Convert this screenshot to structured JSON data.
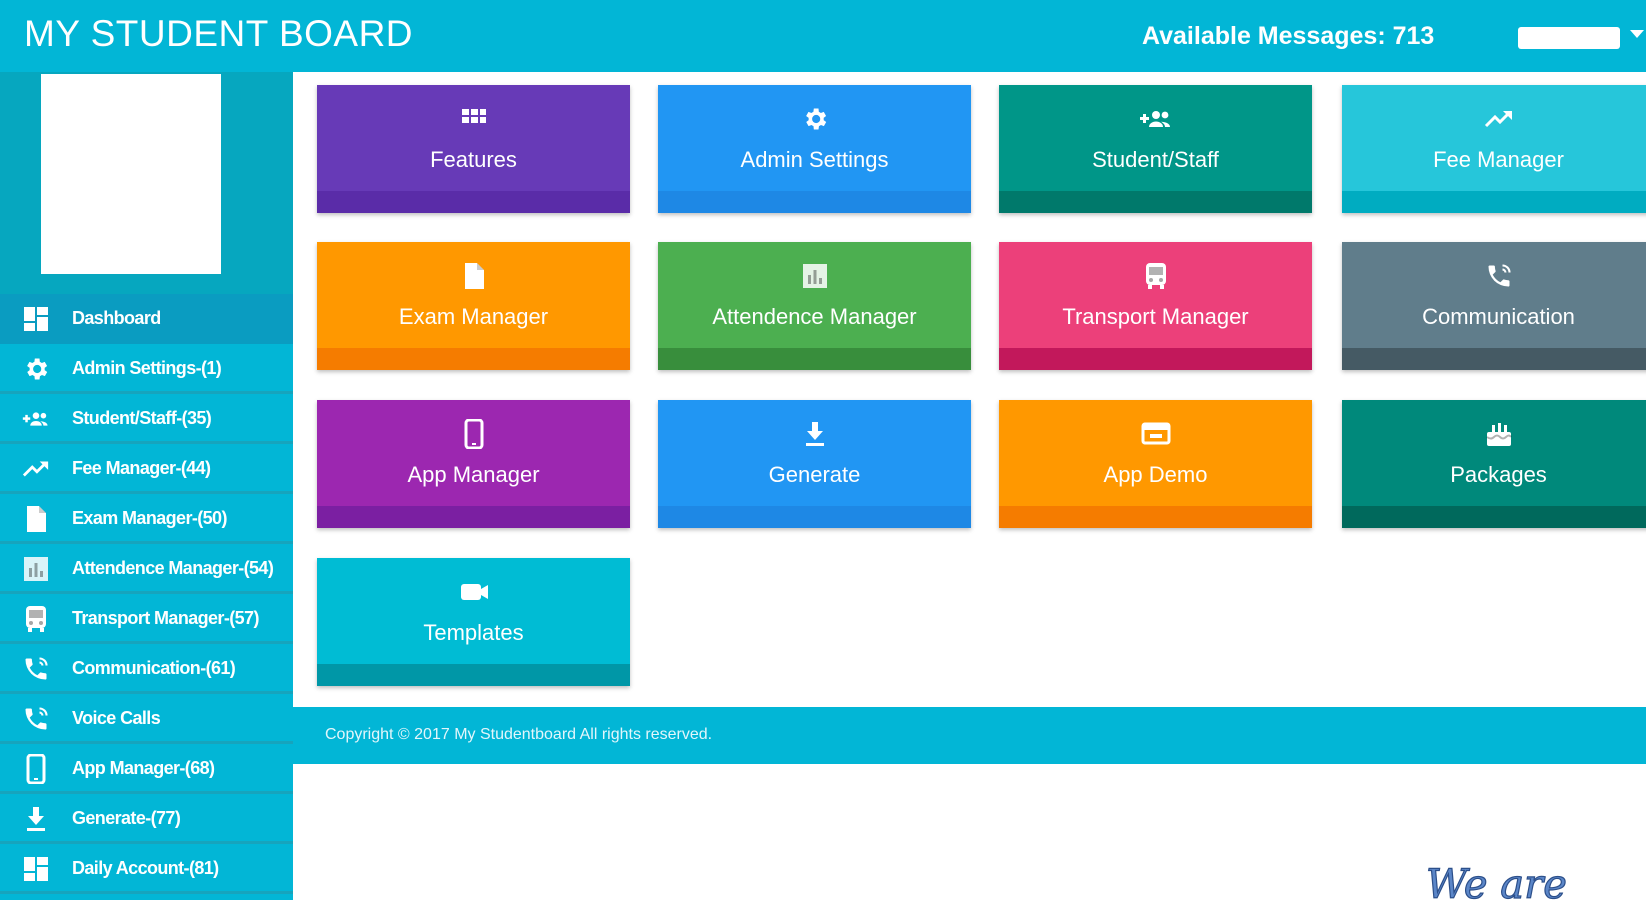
{
  "header": {
    "brand": "MY STUDENT BOARD",
    "available_messages": "Available Messages: 713"
  },
  "sidebar": {
    "items": [
      {
        "label": "Dashboard",
        "icon": "dashboard-icon",
        "active": true
      },
      {
        "label": "Admin Settings-(1)",
        "icon": "gear-icon"
      },
      {
        "label": "Student/Staff-(35)",
        "icon": "add-group-icon"
      },
      {
        "label": "Fee Manager-(44)",
        "icon": "trending-up-icon"
      },
      {
        "label": "Exam Manager-(50)",
        "icon": "document-icon"
      },
      {
        "label": "Attendence Manager-(54)",
        "icon": "bar-chart-icon"
      },
      {
        "label": "Transport Manager-(57)",
        "icon": "bus-icon"
      },
      {
        "label": "Communication-(61)",
        "icon": "phone-icon"
      },
      {
        "label": "Voice Calls",
        "icon": "phone-icon"
      },
      {
        "label": "App Manager-(68)",
        "icon": "mobile-icon"
      },
      {
        "label": "Generate-(77)",
        "icon": "download-icon"
      },
      {
        "label": "Daily Account-(81)",
        "icon": "dashboard-icon"
      }
    ]
  },
  "tiles": [
    {
      "label": "Features",
      "icon": "grid-icon",
      "color": "#673ab7",
      "strip": "#5a2ca8"
    },
    {
      "label": "Admin Settings",
      "icon": "gear-icon",
      "color": "#2196f3",
      "strip": "#1e88e5"
    },
    {
      "label": "Student/Staff",
      "icon": "add-group-icon",
      "color": "#009688",
      "strip": "#00796b"
    },
    {
      "label": "Fee Manager",
      "icon": "trending-up-icon",
      "color": "#26c6da",
      "strip": "#00acc1"
    },
    {
      "label": "Exam Manager",
      "icon": "document-icon",
      "color": "#ff9800",
      "strip": "#f57c00"
    },
    {
      "label": "Attendence Manager",
      "icon": "bar-chart-icon",
      "color": "#4caf50",
      "strip": "#388e3c"
    },
    {
      "label": "Transport Manager",
      "icon": "bus-icon",
      "color": "#ec407a",
      "strip": "#c2185b"
    },
    {
      "label": "Communication",
      "icon": "phone-icon",
      "color": "#607d8b",
      "strip": "#455a64"
    },
    {
      "label": "App Manager",
      "icon": "mobile-icon",
      "color": "#9c27b0",
      "strip": "#7b1fa2"
    },
    {
      "label": "Generate",
      "icon": "download-icon",
      "color": "#2196f3",
      "strip": "#1e88e5"
    },
    {
      "label": "App Demo",
      "icon": "presentation-icon",
      "color": "#ff9800",
      "strip": "#f57c00"
    },
    {
      "label": "Packages",
      "icon": "cake-icon",
      "color": "#00897b",
      "strip": "#00695c"
    },
    {
      "label": "Templates",
      "icon": "video-icon",
      "color": "#00bcd4",
      "strip": "#0097a7"
    }
  ],
  "footer": {
    "copyright": "Copyright © 2017 My Studentboard All rights reserved."
  },
  "watermark": "We are"
}
